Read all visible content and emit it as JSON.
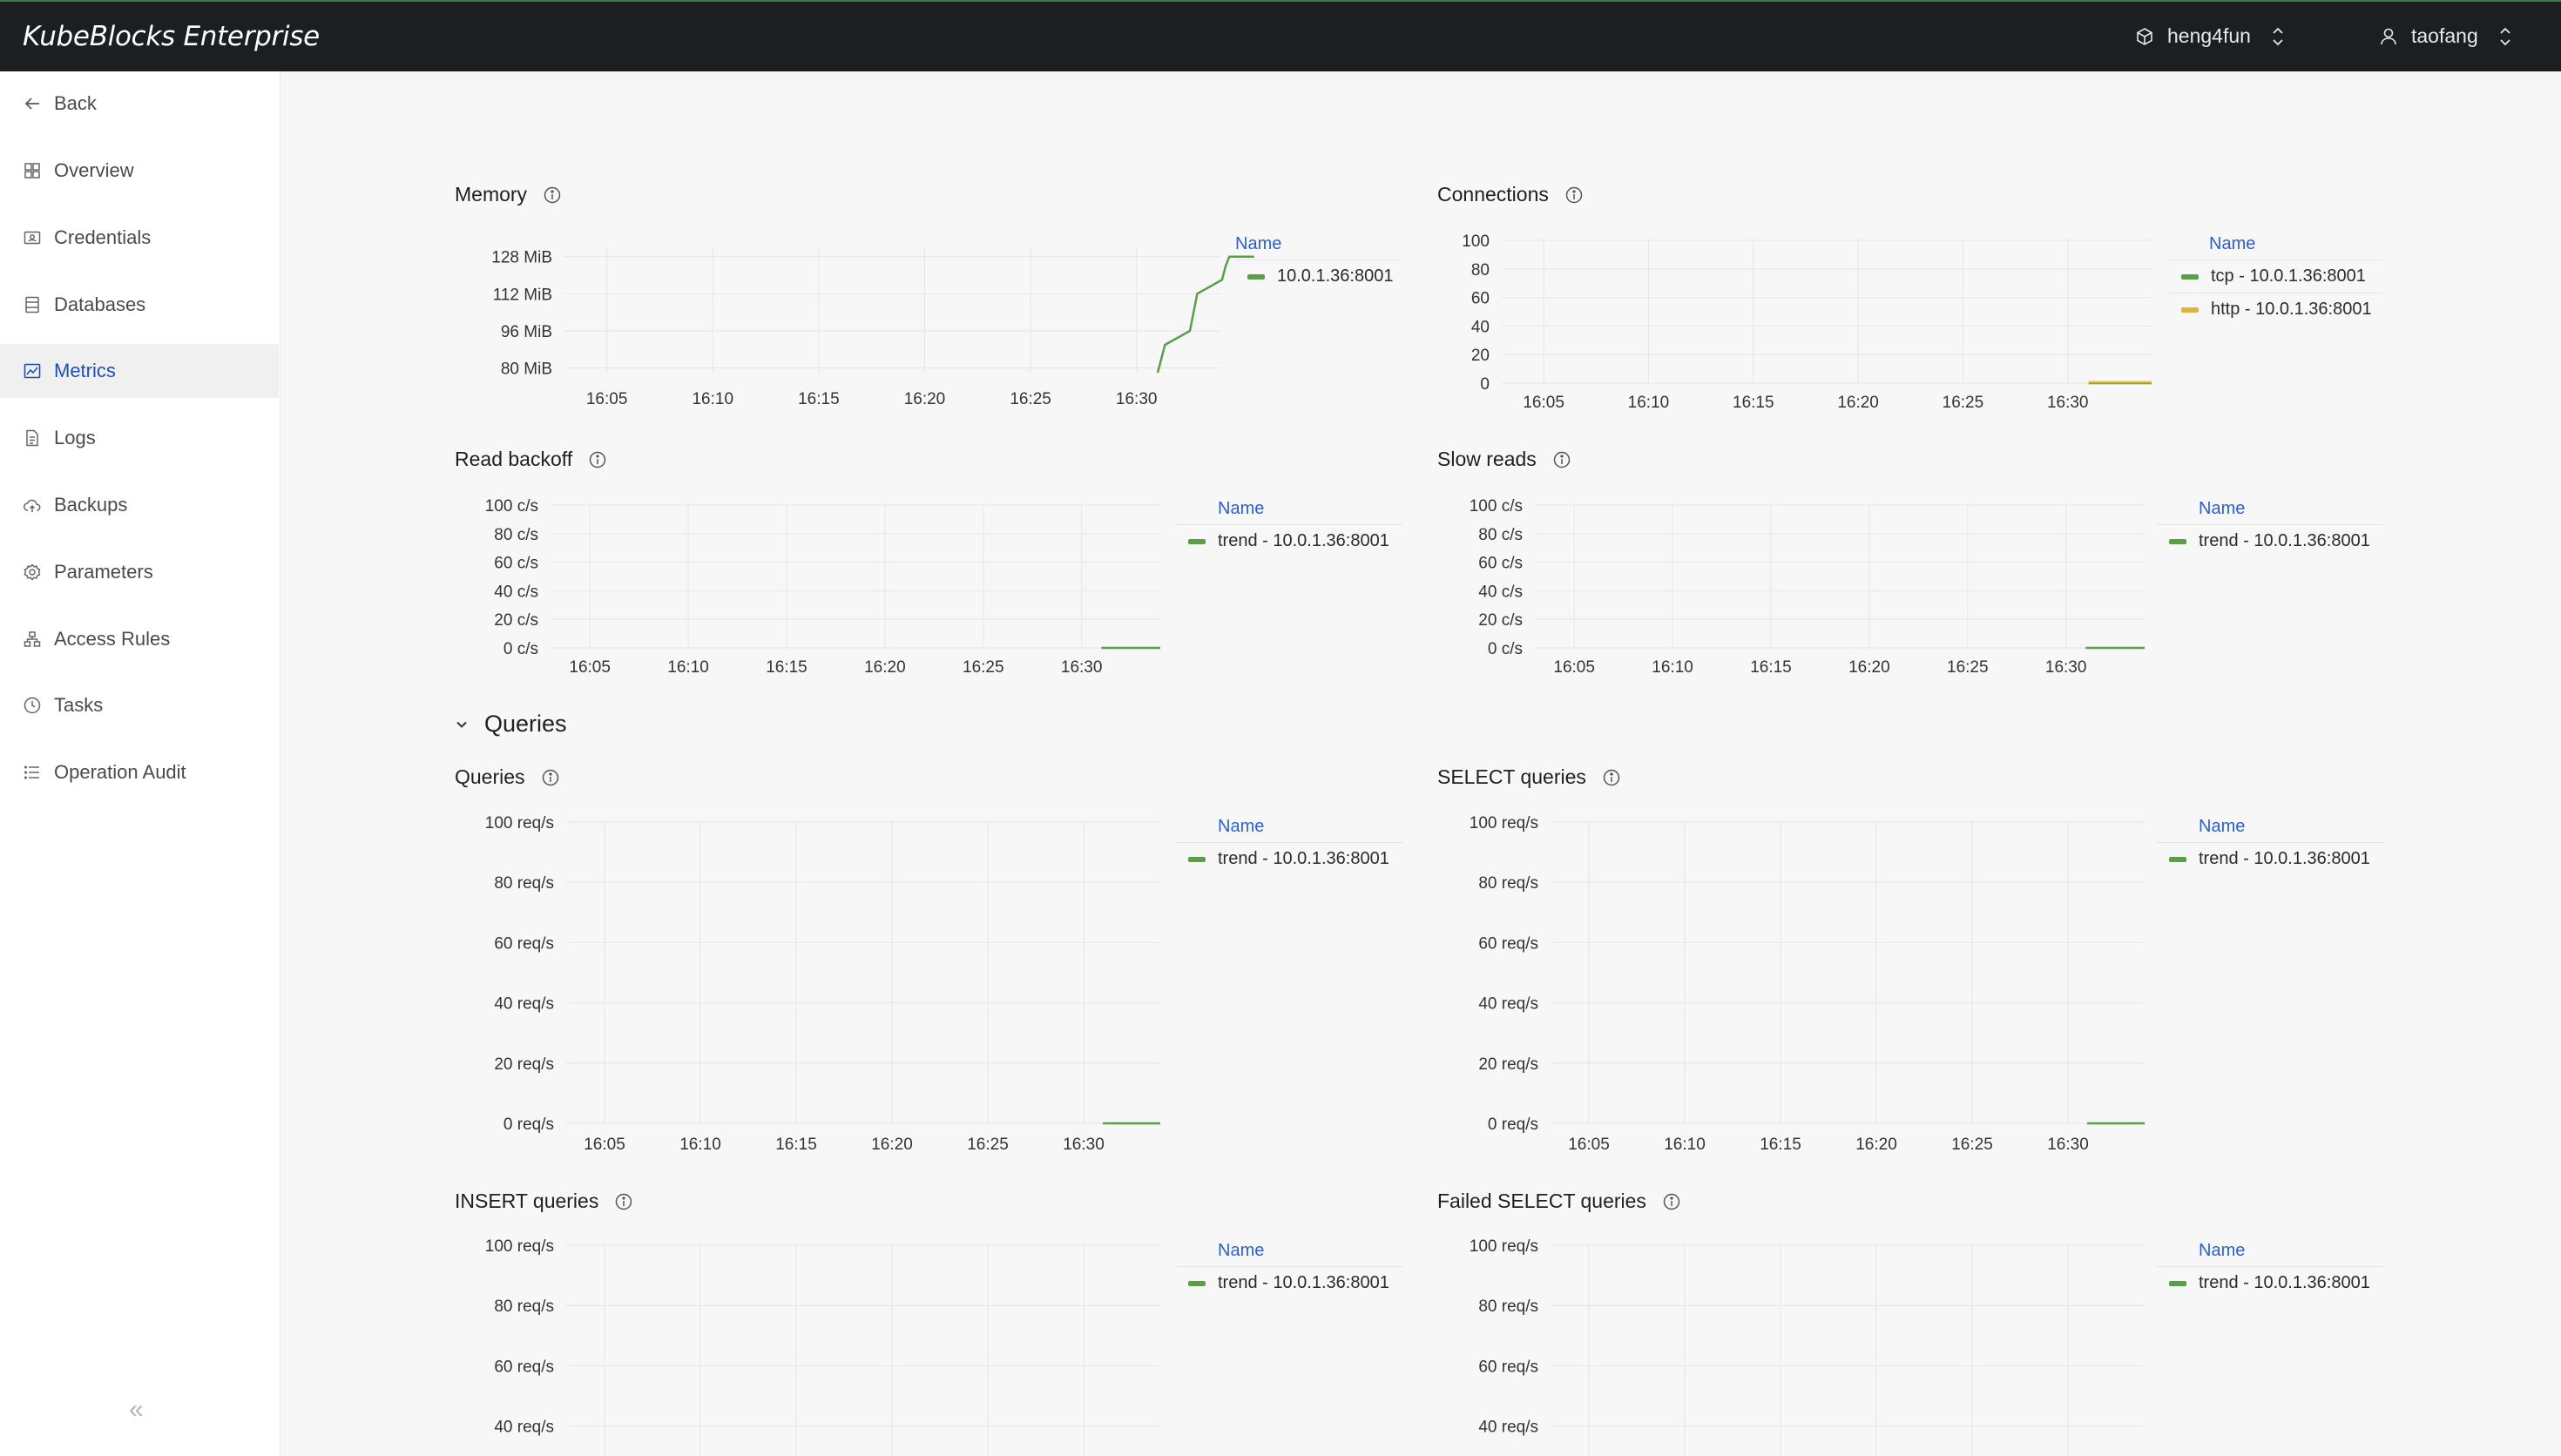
{
  "app": {
    "title": "KubeBlocks Enterprise",
    "org": "heng4fun",
    "user": "taofang"
  },
  "sidebar": {
    "back": "Back",
    "items": [
      {
        "label": "Overview",
        "icon": "grid-icon"
      },
      {
        "label": "Credentials",
        "icon": "key-card-icon"
      },
      {
        "label": "Databases",
        "icon": "database-icon"
      },
      {
        "label": "Metrics",
        "icon": "chart-icon",
        "active": true
      },
      {
        "label": "Logs",
        "icon": "document-icon"
      },
      {
        "label": "Backups",
        "icon": "cloud-upload-icon"
      },
      {
        "label": "Parameters",
        "icon": "gear-icon"
      },
      {
        "label": "Access Rules",
        "icon": "network-icon"
      },
      {
        "label": "Tasks",
        "icon": "clock-icon"
      },
      {
        "label": "Operation Audit",
        "icon": "list-icon"
      }
    ],
    "collapse_label": "«"
  },
  "colors": {
    "green": "#5a9e47",
    "yellow": "#e0b43a",
    "accent": "#1d4fb8"
  },
  "legend_header": "Name",
  "section": {
    "title": "Queries"
  },
  "panels": {
    "memory": {
      "title": "Memory",
      "legend": [
        "10.0.1.36:8001"
      ]
    },
    "connections": {
      "title": "Connections",
      "legend": [
        "tcp - 10.0.1.36:8001",
        "http - 10.0.1.36:8001"
      ]
    },
    "read_backoff": {
      "title": "Read backoff",
      "legend": [
        "trend - 10.0.1.36:8001"
      ]
    },
    "slow_reads": {
      "title": "Slow reads",
      "legend": [
        "trend - 10.0.1.36:8001"
      ]
    },
    "queries": {
      "title": "Queries",
      "legend": [
        "trend - 10.0.1.36:8001"
      ]
    },
    "select_queries": {
      "title": "SELECT queries",
      "legend": [
        "trend - 10.0.1.36:8001"
      ]
    },
    "insert_queries": {
      "title": "INSERT queries",
      "legend": [
        "trend - 10.0.1.36:8001"
      ]
    },
    "failed_select": {
      "title": "Failed SELECT queries",
      "legend": [
        "trend - 10.0.1.36:8001"
      ]
    }
  },
  "chart_data": [
    {
      "id": "memory",
      "type": "line",
      "title": "Memory",
      "x_ticks": [
        "16:05",
        "16:10",
        "16:15",
        "16:20",
        "16:25",
        "16:30"
      ],
      "y_ticks": [
        "128 MiB",
        "112 MiB",
        "96 MiB",
        "80 MiB"
      ],
      "ylim": [
        78,
        132
      ],
      "series": [
        {
          "name": "10.0.1.36:8001",
          "color": "#5a9e47",
          "points": [
            [
              "16:31",
              78
            ],
            [
              "16:31",
              84
            ],
            [
              "16:31",
              90
            ],
            [
              "16:32",
              96
            ],
            [
              "16:32",
              104
            ],
            [
              "16:32",
              112
            ],
            [
              "16:33",
              118
            ],
            [
              "16:33",
              124
            ],
            [
              "16:33",
              128
            ],
            [
              "16:34",
              128
            ]
          ]
        }
      ]
    },
    {
      "id": "connections",
      "type": "line",
      "title": "Connections",
      "x_ticks": [
        "16:05",
        "16:10",
        "16:15",
        "16:20",
        "16:25",
        "16:30"
      ],
      "y_ticks": [
        "100",
        "80",
        "60",
        "40",
        "20",
        "0"
      ],
      "ylim": [
        0,
        100
      ],
      "series": [
        {
          "name": "tcp - 10.0.1.36:8001",
          "color": "#5a9e47",
          "points": [
            [
              "16:31",
              0
            ],
            [
              "16:34",
              0
            ]
          ]
        },
        {
          "name": "http - 10.0.1.36:8001",
          "color": "#e0b43a",
          "points": [
            [
              "16:31",
              0
            ],
            [
              "16:34",
              0
            ]
          ]
        }
      ]
    },
    {
      "id": "read_backoff",
      "type": "line",
      "title": "Read backoff",
      "x_ticks": [
        "16:05",
        "16:10",
        "16:15",
        "16:20",
        "16:25",
        "16:30"
      ],
      "y_ticks": [
        "100 c/s",
        "80 c/s",
        "60 c/s",
        "40 c/s",
        "20 c/s",
        "0 c/s"
      ],
      "ylim": [
        0,
        100
      ],
      "series": [
        {
          "name": "trend - 10.0.1.36:8001",
          "color": "#5a9e47",
          "points": [
            [
              "16:31",
              0
            ],
            [
              "16:34",
              0
            ]
          ]
        }
      ]
    },
    {
      "id": "slow_reads",
      "type": "line",
      "title": "Slow reads",
      "x_ticks": [
        "16:05",
        "16:10",
        "16:15",
        "16:20",
        "16:25",
        "16:30"
      ],
      "y_ticks": [
        "100 c/s",
        "80 c/s",
        "60 c/s",
        "40 c/s",
        "20 c/s",
        "0 c/s"
      ],
      "ylim": [
        0,
        100
      ],
      "series": [
        {
          "name": "trend - 10.0.1.36:8001",
          "color": "#5a9e47",
          "points": [
            [
              "16:31",
              0
            ],
            [
              "16:34",
              0
            ]
          ]
        }
      ]
    },
    {
      "id": "queries",
      "type": "line",
      "title": "Queries",
      "x_ticks": [
        "16:05",
        "16:10",
        "16:15",
        "16:20",
        "16:25",
        "16:30"
      ],
      "y_ticks": [
        "100 req/s",
        "80 req/s",
        "60 req/s",
        "40 req/s",
        "20 req/s",
        "0 req/s"
      ],
      "ylim": [
        0,
        100
      ],
      "series": [
        {
          "name": "trend - 10.0.1.36:8001",
          "color": "#5a9e47",
          "points": [
            [
              "16:31",
              0
            ],
            [
              "16:34",
              0
            ]
          ]
        }
      ]
    },
    {
      "id": "select_queries",
      "type": "line",
      "title": "SELECT queries",
      "x_ticks": [
        "16:05",
        "16:10",
        "16:15",
        "16:20",
        "16:25",
        "16:30"
      ],
      "y_ticks": [
        "100 req/s",
        "80 req/s",
        "60 req/s",
        "40 req/s",
        "20 req/s",
        "0 req/s"
      ],
      "ylim": [
        0,
        100
      ],
      "series": [
        {
          "name": "trend - 10.0.1.36:8001",
          "color": "#5a9e47",
          "points": [
            [
              "16:31",
              0
            ],
            [
              "16:34",
              0
            ]
          ]
        }
      ]
    },
    {
      "id": "insert_queries",
      "type": "line",
      "title": "INSERT queries",
      "y_ticks": [
        "100 req/s",
        "80 req/s",
        "60 req/s",
        "40 req/s"
      ],
      "ylim": [
        0,
        100
      ],
      "series": [
        {
          "name": "trend - 10.0.1.36:8001",
          "color": "#5a9e47",
          "points": []
        }
      ]
    },
    {
      "id": "failed_select",
      "type": "line",
      "title": "Failed SELECT queries",
      "y_ticks": [
        "100 req/s",
        "80 req/s",
        "60 req/s",
        "40 req/s"
      ],
      "ylim": [
        0,
        100
      ],
      "series": [
        {
          "name": "trend - 10.0.1.36:8001",
          "color": "#5a9e47",
          "points": []
        }
      ]
    }
  ]
}
